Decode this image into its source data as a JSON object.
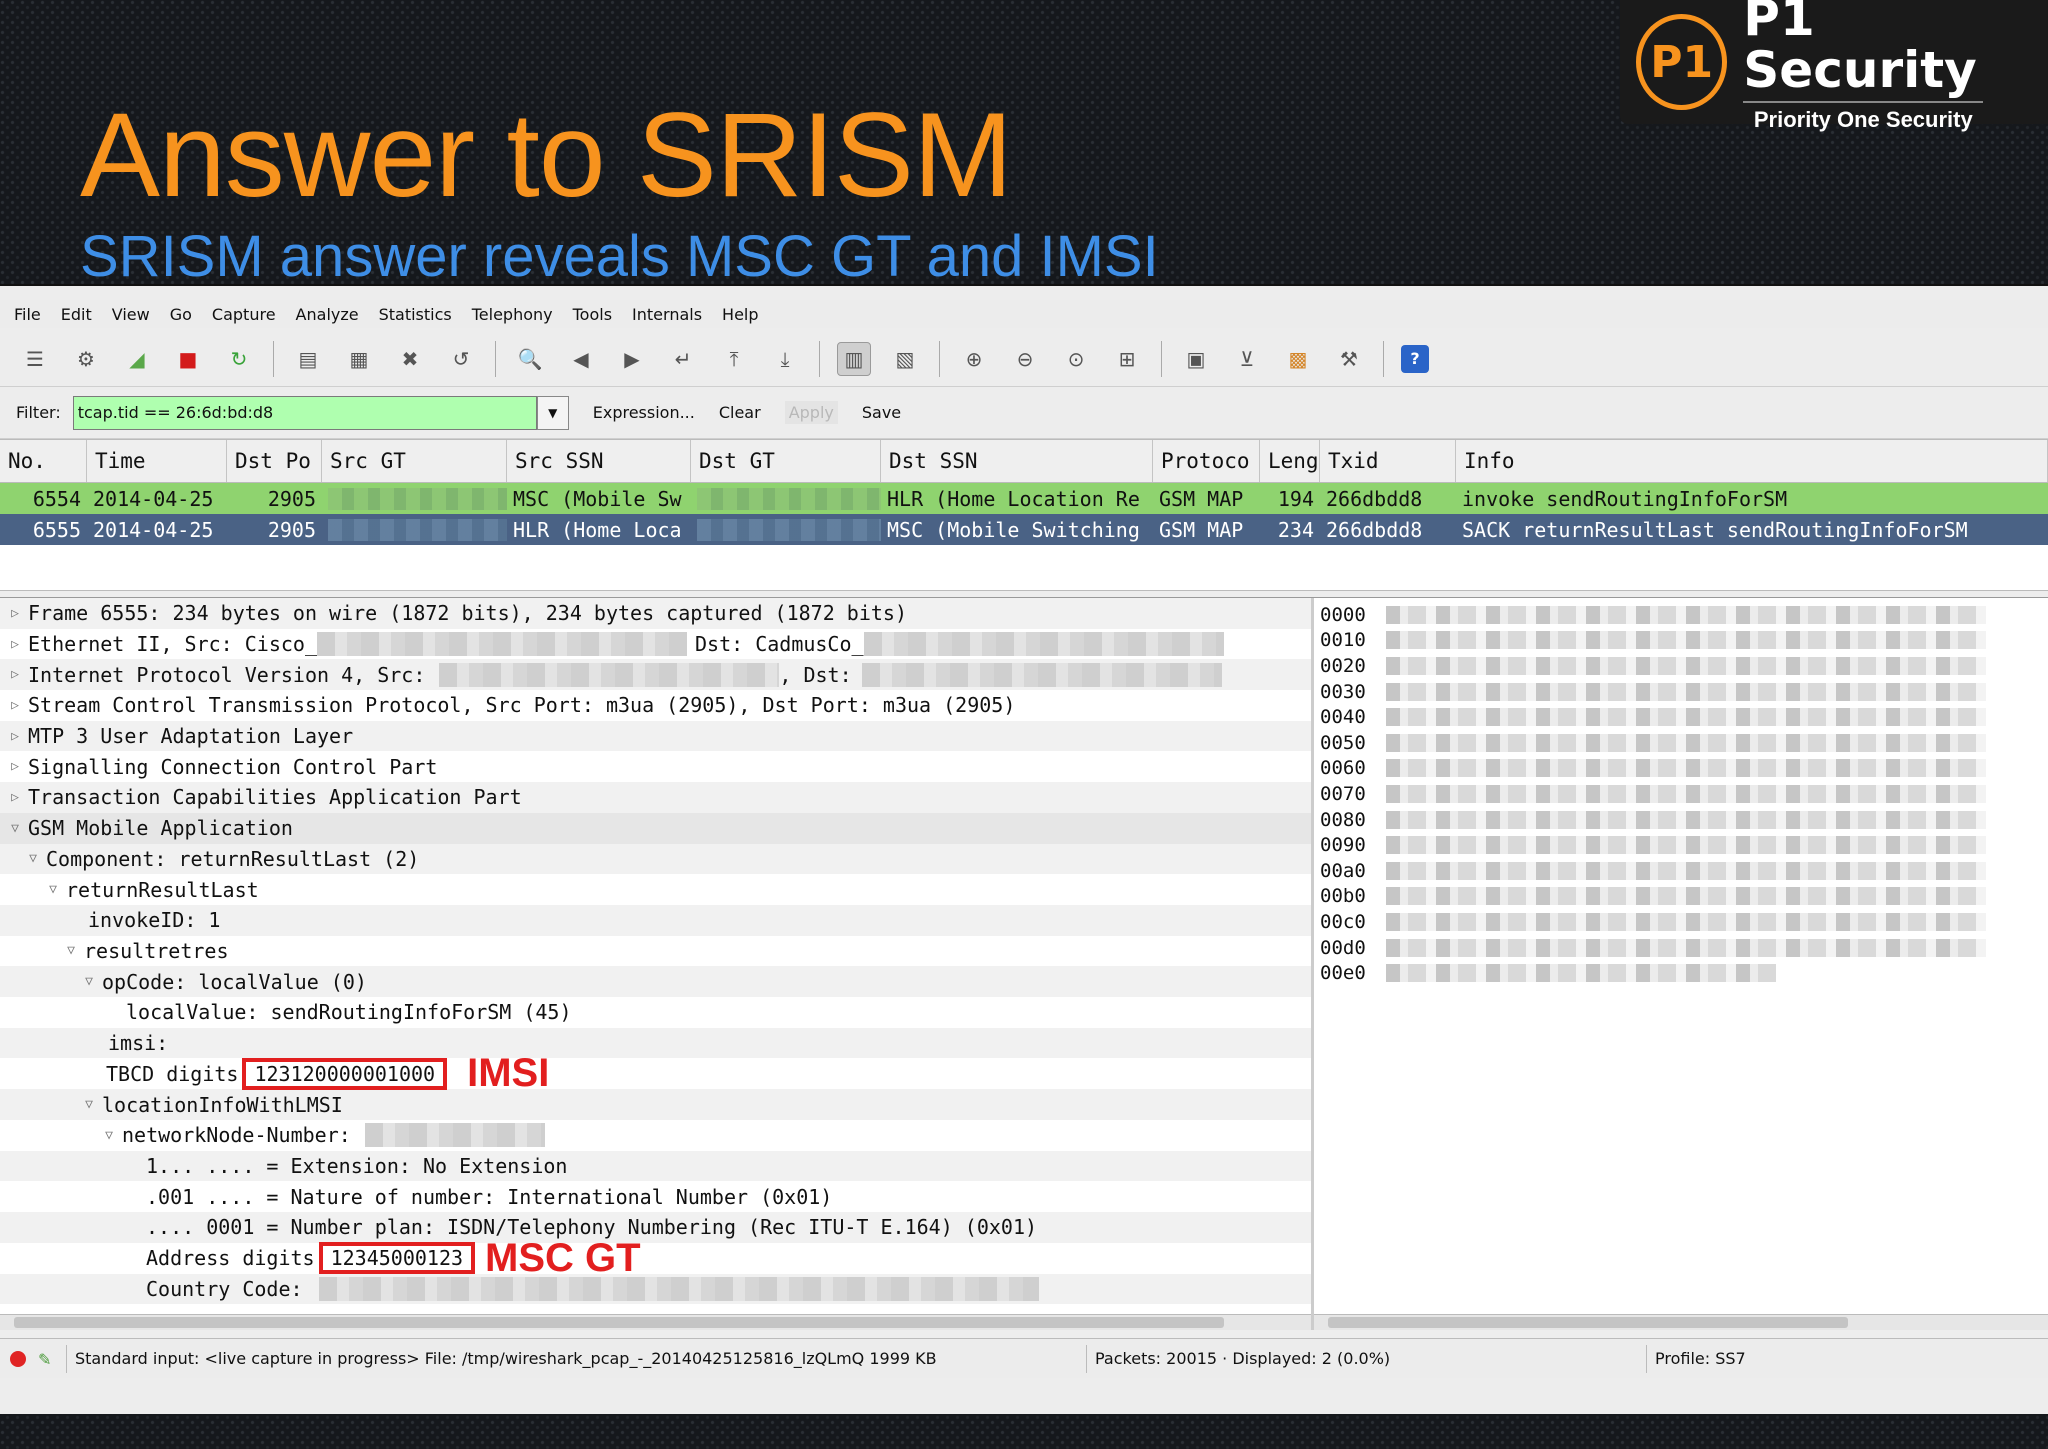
{
  "slide": {
    "title": "Answer to SRISM",
    "subtitle": "SRISM answer reveals MSC GT and IMSI",
    "logo": {
      "mark": "P1",
      "name": "P1 Security",
      "tagline": "Priority One Security"
    }
  },
  "menu": [
    "File",
    "Edit",
    "View",
    "Go",
    "Capture",
    "Analyze",
    "Statistics",
    "Telephony",
    "Tools",
    "Internals",
    "Help"
  ],
  "filter": {
    "label": "Filter:",
    "value": "tcap.tid == 26:6d:bd:d8",
    "expression": "Expression...",
    "clear": "Clear",
    "apply": "Apply",
    "save": "Save"
  },
  "columns": [
    "No.",
    "Time",
    "Dst Po",
    "Src GT",
    "Src SSN",
    "Dst GT",
    "Dst SSN",
    "Protoco",
    "Leng",
    "Txid",
    "Info"
  ],
  "packets": [
    {
      "no": "6554",
      "time": "2014-04-25",
      "dstport": "2905",
      "srcssn": "MSC (Mobile Sw",
      "dstssn": "HLR (Home Location Re",
      "proto": "GSM MAP",
      "len": "194",
      "txid": "266dbdd8",
      "info": "invoke sendRoutingInfoForSM"
    },
    {
      "no": "6555",
      "time": "2014-04-25",
      "dstport": "2905",
      "srcssn": "HLR (Home Loca",
      "dstssn": "MSC (Mobile Switching",
      "proto": "GSM MAP",
      "len": "234",
      "txid": "266dbdd8",
      "info": "SACK returnResultLast sendRoutingInfoForSM"
    }
  ],
  "tree": {
    "frame": "Frame 6555: 234 bytes on wire (1872 bits), 234 bytes captured (1872 bits)",
    "eth_a": "Ethernet II, Src: Cisco_",
    "eth_b": "Dst: CadmusCo_",
    "ip_a": "Internet Protocol Version 4, Src:",
    "ip_b": ", Dst:",
    "sctp": "Stream Control Transmission Protocol, Src Port: m3ua (2905), Dst Port: m3ua (2905)",
    "m3ua": "MTP 3 User Adaptation Layer",
    "sccp": "Signalling Connection Control Part",
    "tcap": "Transaction Capabilities Application Part",
    "gsm": "GSM Mobile Application",
    "component": "Component: returnResultLast (2)",
    "rrl": "returnResultLast",
    "invokeid": "invokeID: 1",
    "resultretres": "resultretres",
    "opcode": "opCode: localValue (0)",
    "localvalue": "localValue: sendRoutingInfoForSM (45)",
    "imsi": "imsi:",
    "tbcd_label": "TBCD digits",
    "tbcd_value": "123120000001000",
    "imsi_annot": "IMSI",
    "lilmsi": "locationInfoWithLMSI",
    "nnn": "networkNode-Number:",
    "ext": "1... .... = Extension: No Extension",
    "nature": ".001 .... = Nature of number: International Number (0x01)",
    "plan": ".... 0001 = Number plan: ISDN/Telephony Numbering (Rec ITU-T E.164) (0x01)",
    "addr_label": "Address digits",
    "addr_value": "12345000123",
    "msc_annot": "MSC GT",
    "country": "Country Code:"
  },
  "hex_offsets": [
    "0000",
    "0010",
    "0020",
    "0030",
    "0040",
    "0050",
    "0060",
    "0070",
    "0080",
    "0090",
    "00a0",
    "00b0",
    "00c0",
    "00d0",
    "00e0"
  ],
  "status": {
    "capture": "Standard input: <live capture in progress> File: /tmp/wireshark_pcap_-_20140425125816_lzQLmQ 1999 KB",
    "packets": "Packets: 20015 · Displayed: 2 (0.0%)",
    "profile": "Profile: SS7"
  }
}
